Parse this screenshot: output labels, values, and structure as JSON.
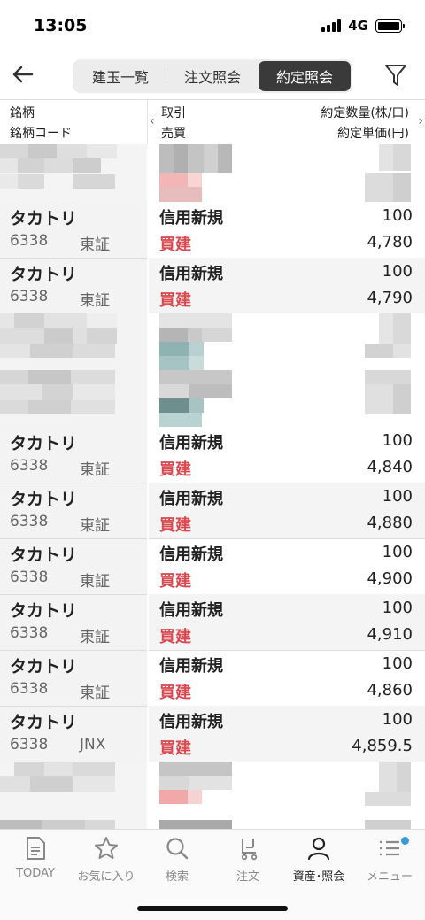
{
  "status": {
    "time": "13:05",
    "network": "4G"
  },
  "tabs": [
    {
      "label": "建玉一覧"
    },
    {
      "label": "注文照会"
    },
    {
      "label": "約定照会"
    }
  ],
  "header": {
    "col1_top": "銘柄",
    "col1_bottom": "銘柄コード",
    "col2_top": "取引",
    "col2_bottom": "売買",
    "col3_top": "約定数量(株/口)",
    "col3_bottom": "約定単価(円)"
  },
  "rows": [
    {
      "name": "タカトリ",
      "code": "6338",
      "market": "東証",
      "trade": "信用新規",
      "side": "買建",
      "qty": "100",
      "price": "4,780"
    },
    {
      "name": "タカトリ",
      "code": "6338",
      "market": "東証",
      "trade": "信用新規",
      "side": "買建",
      "qty": "100",
      "price": "4,790"
    },
    {
      "name": "タカトリ",
      "code": "6338",
      "market": "東証",
      "trade": "信用新規",
      "side": "買建",
      "qty": "100",
      "price": "4,840"
    },
    {
      "name": "タカトリ",
      "code": "6338",
      "market": "東証",
      "trade": "信用新規",
      "side": "買建",
      "qty": "100",
      "price": "4,880"
    },
    {
      "name": "タカトリ",
      "code": "6338",
      "market": "東証",
      "trade": "信用新規",
      "side": "買建",
      "qty": "100",
      "price": "4,900"
    },
    {
      "name": "タカトリ",
      "code": "6338",
      "market": "東証",
      "trade": "信用新規",
      "side": "買建",
      "qty": "100",
      "price": "4,910"
    },
    {
      "name": "タカトリ",
      "code": "6338",
      "market": "東証",
      "trade": "信用新規",
      "side": "買建",
      "qty": "100",
      "price": "4,860"
    },
    {
      "name": "タカトリ",
      "code": "6338",
      "market": "JNX",
      "trade": "信用新規",
      "side": "買建",
      "qty": "100",
      "price": "4,859.5"
    }
  ],
  "bottom_tabs": [
    {
      "label": "TODAY",
      "icon": "document-icon"
    },
    {
      "label": "お気に入り",
      "icon": "star-icon"
    },
    {
      "label": "検索",
      "icon": "search-icon"
    },
    {
      "label": "注文",
      "icon": "cart-icon"
    },
    {
      "label": "資産･照会",
      "icon": "person-icon"
    },
    {
      "label": "メニュー",
      "icon": "menu-list-icon"
    }
  ],
  "colors": {
    "accent_red": "#d9484f",
    "badge_blue": "#3a9ad9",
    "active_tab_bg": "#3a3a3a"
  }
}
